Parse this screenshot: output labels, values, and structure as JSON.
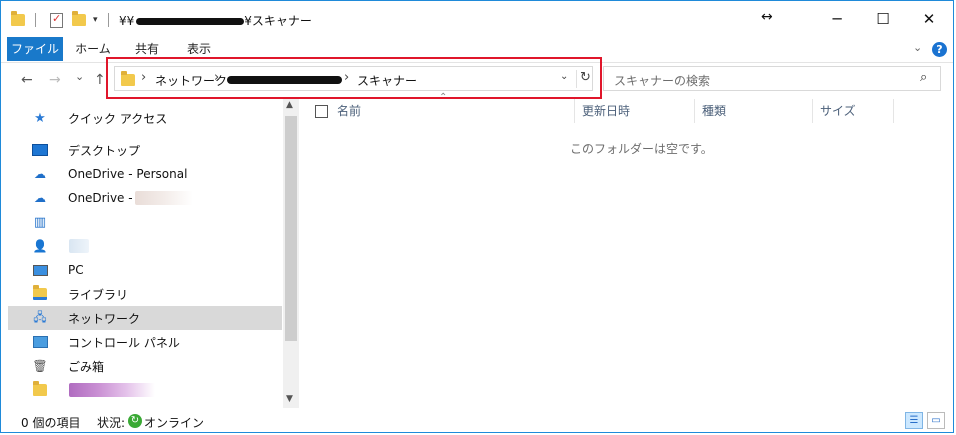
{
  "window": {
    "title_prefix": "¥¥",
    "title_suffix": "¥スキャナー",
    "resize_glyph": "↔",
    "controls": {
      "minimize": "─",
      "maximize": "☐",
      "close": "✕"
    }
  },
  "ribbon": {
    "tabs": [
      {
        "label": "ファイル"
      },
      {
        "label": "ホーム"
      },
      {
        "label": "共有"
      },
      {
        "label": "表示"
      }
    ],
    "help": "?"
  },
  "navigation": {
    "back": "←",
    "forward": "→",
    "recent": "⌄",
    "up": "↑"
  },
  "address": {
    "crumbs": [
      "ネットワーク",
      "スキャナー"
    ],
    "separator": "›",
    "dropdown": "⌄",
    "refresh": "↻"
  },
  "search": {
    "placeholder": "スキャナーの検索",
    "icon": "⌕"
  },
  "nav_pane": {
    "items": [
      {
        "label": "クイック アクセス",
        "icon": "star-icon"
      },
      {
        "label": "デスクトップ",
        "icon": "desktop-icon"
      },
      {
        "label": "OneDrive - Personal",
        "icon": "cloud-icon"
      },
      {
        "label": "OneDrive -",
        "icon": "cloud-icon"
      },
      {
        "label": "",
        "icon": "building-icon"
      },
      {
        "label": "",
        "icon": "user-icon"
      },
      {
        "label": "PC",
        "icon": "pc-icon"
      },
      {
        "label": "ライブラリ",
        "icon": "library-icon"
      },
      {
        "label": "ネットワーク",
        "icon": "network-icon",
        "selected": true
      },
      {
        "label": "コントロール パネル",
        "icon": "control-panel-icon"
      },
      {
        "label": "ごみ箱",
        "icon": "recycle-bin-icon"
      },
      {
        "label": "",
        "icon": "folder-icon"
      }
    ]
  },
  "columns": [
    {
      "label": "名前"
    },
    {
      "label": "更新日時"
    },
    {
      "label": "種類"
    },
    {
      "label": "サイズ"
    }
  ],
  "content": {
    "empty_message": "このフォルダーは空です。"
  },
  "status": {
    "item_count": "0 個の項目",
    "state_label": "状況:",
    "state_value": "オンライン"
  },
  "colors": {
    "accent": "#1979ca",
    "highlight_box": "#e0162b",
    "selected_row": "#d9d9d9"
  }
}
